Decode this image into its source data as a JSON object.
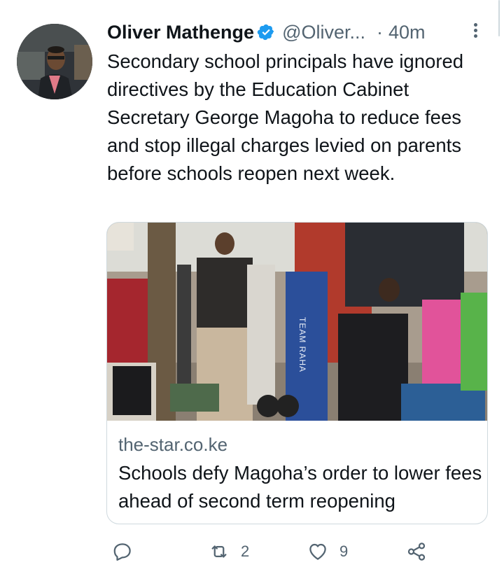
{
  "tweet": {
    "author_name": "Oliver Mathenge",
    "handle": "@Oliver...",
    "separator": "·",
    "time": "40m",
    "text": "Secondary school principals have ignored directives by the Education Cabinet Secretary George Magoha to reduce fees and stop illegal charges levied on parents before schools reopen next week.",
    "verified": true
  },
  "card": {
    "domain": "the-star.co.ke",
    "title": "Schools defy Magoha’s order to lower fees ahead of second term reopening",
    "image_sign_text": "TEAM RAHA"
  },
  "actions": {
    "reply_count": "",
    "retweet_count": "2",
    "like_count": "9"
  },
  "icons": {
    "more": "more-vertical-icon",
    "verified": "verified-badge-icon",
    "reply": "reply-icon",
    "retweet": "retweet-icon",
    "like": "heart-icon",
    "share": "share-icon"
  },
  "colors": {
    "verified_blue": "#1d9bf0",
    "secondary_text": "#536471",
    "primary_text": "#0f1419",
    "border": "#cfd9de"
  }
}
